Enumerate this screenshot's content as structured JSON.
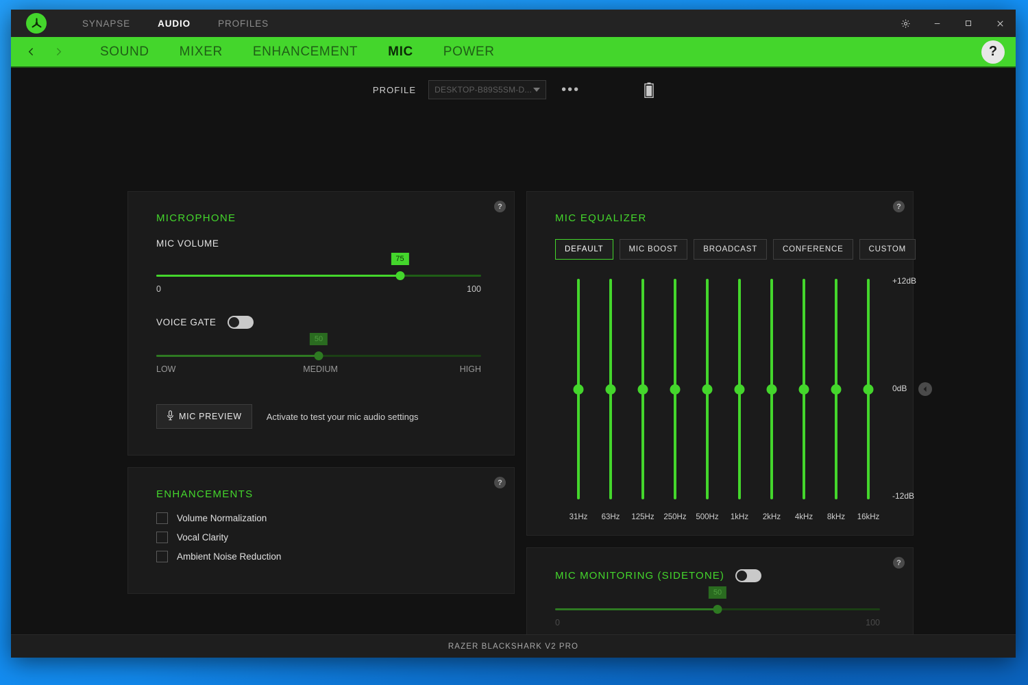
{
  "window": {
    "footer_text": "RAZER BLACKSHARK V2 PRO",
    "accent_green": "#44d62c",
    "bg_dark": "#121212",
    "panel_bg": "#1b1b1b"
  },
  "titlebar": {
    "logo_icon": "razer-logo-icon",
    "tabs": [
      {
        "label": "SYNAPSE",
        "active": false
      },
      {
        "label": "AUDIO",
        "active": true
      },
      {
        "label": "PROFILES",
        "active": false
      }
    ],
    "controls": [
      {
        "name": "settings-gear-button",
        "icon": "gear-icon"
      },
      {
        "name": "minimize-button",
        "icon": "minimize-icon"
      },
      {
        "name": "maximize-button",
        "icon": "maximize-icon"
      },
      {
        "name": "close-button",
        "icon": "close-icon"
      }
    ]
  },
  "subnav": {
    "back_icon": "chevron-left-icon",
    "forward_icon": "chevron-right-icon",
    "tabs": [
      {
        "label": "SOUND",
        "active": false
      },
      {
        "label": "MIXER",
        "active": false
      },
      {
        "label": "ENHANCEMENT",
        "active": false
      },
      {
        "label": "MIC",
        "active": true
      },
      {
        "label": "POWER",
        "active": false
      }
    ],
    "help_label": "?"
  },
  "profile_bar": {
    "label": "PROFILE",
    "selected": "DESKTOP-B89S5SM-D...",
    "placeholder": "DESKTOP-B89S5SM-D...",
    "more_label": "•••",
    "battery_icon": "battery-icon"
  },
  "microphone_panel": {
    "title": "MICROPHONE",
    "help_label": "?",
    "mic_volume": {
      "label": "MIC VOLUME",
      "value": 75,
      "min_label": "0",
      "max_label": "100",
      "min": 0,
      "max": 100
    },
    "voice_gate": {
      "label": "VOICE GATE",
      "enabled": false,
      "value": 50,
      "min": 0,
      "max": 100,
      "scale_labels": [
        "LOW",
        "MEDIUM",
        "HIGH"
      ]
    },
    "mic_preview": {
      "button_label": "MIC PREVIEW",
      "icon": "microphone-icon",
      "hint": "Activate to test your mic audio settings"
    }
  },
  "enhancements_panel": {
    "title": "ENHANCEMENTS",
    "help_label": "?",
    "items": [
      {
        "label": "Volume Normalization",
        "checked": false
      },
      {
        "label": "Vocal Clarity",
        "checked": false
      },
      {
        "label": "Ambient Noise Reduction",
        "checked": false
      }
    ]
  },
  "mic_equalizer_panel": {
    "title": "MIC EQUALIZER",
    "help_label": "?",
    "presets": [
      {
        "label": "DEFAULT",
        "active": true
      },
      {
        "label": "MIC BOOST",
        "active": false
      },
      {
        "label": "BROADCAST",
        "active": false
      },
      {
        "label": "CONFERENCE",
        "active": false
      },
      {
        "label": "CUSTOM",
        "active": false
      }
    ],
    "db_top_label": "+12dB",
    "db_mid_label": "0dB",
    "db_bottom_label": "-12dB",
    "collapse_icon": "chevron-left-icon"
  },
  "mic_monitoring_panel": {
    "title": "MIC MONITORING (SIDETONE)",
    "help_label": "?",
    "enabled": false,
    "value": 50,
    "min_label": "0",
    "max_label": "100",
    "min": 0,
    "max": 100
  },
  "chart_data": {
    "type": "bar",
    "title": "MIC EQUALIZER",
    "xlabel": "",
    "ylabel": "dB",
    "ylim": [
      -12,
      12
    ],
    "grid": false,
    "legend": "none",
    "categories": [
      "31Hz",
      "63Hz",
      "125Hz",
      "250Hz",
      "500Hz",
      "1kHz",
      "2kHz",
      "4kHz",
      "8kHz",
      "16kHz"
    ],
    "values": [
      0,
      0,
      0,
      0,
      0,
      0,
      0,
      0,
      0,
      0
    ],
    "tick_labels_y": [
      "+12dB",
      "0dB",
      "-12dB"
    ],
    "preset": "DEFAULT"
  }
}
